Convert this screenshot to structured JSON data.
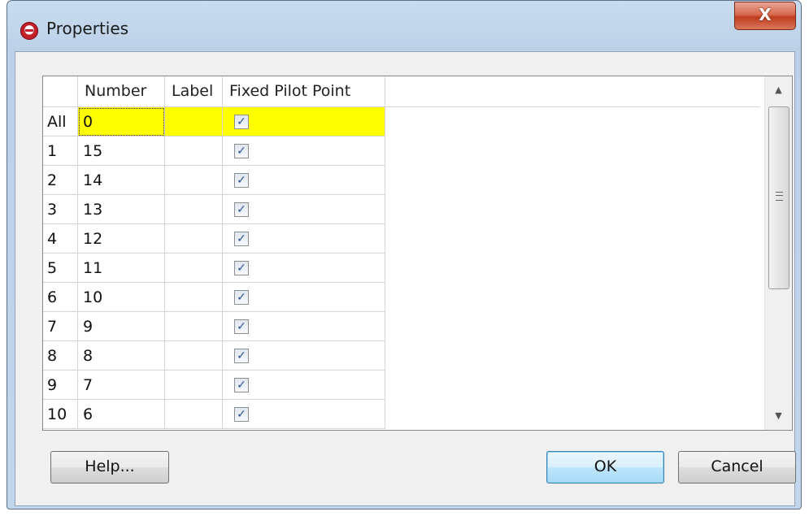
{
  "window": {
    "title": "Properties",
    "close_label": "X"
  },
  "grid": {
    "columns": [
      "Number",
      "Label",
      "Fixed Pilot Point"
    ],
    "rows": [
      {
        "head": "All",
        "number": "0",
        "label": "",
        "fixed": true,
        "highlight": true
      },
      {
        "head": "1",
        "number": "15",
        "label": "",
        "fixed": true
      },
      {
        "head": "2",
        "number": "14",
        "label": "",
        "fixed": true
      },
      {
        "head": "3",
        "number": "13",
        "label": "",
        "fixed": true
      },
      {
        "head": "4",
        "number": "12",
        "label": "",
        "fixed": true
      },
      {
        "head": "5",
        "number": "11",
        "label": "",
        "fixed": true
      },
      {
        "head": "6",
        "number": "10",
        "label": "",
        "fixed": true
      },
      {
        "head": "7",
        "number": "9",
        "label": "",
        "fixed": true
      },
      {
        "head": "8",
        "number": "8",
        "label": "",
        "fixed": true
      },
      {
        "head": "9",
        "number": "7",
        "label": "",
        "fixed": true
      },
      {
        "head": "10",
        "number": "6",
        "label": "",
        "fixed": true
      }
    ],
    "highlight_color": "#ffff00",
    "check_glyph": "✓"
  },
  "scrollbar": {
    "up_glyph": "▲",
    "down_glyph": "▼"
  },
  "buttons": {
    "help_label": "Help...",
    "ok_label": "OK",
    "cancel_label": "Cancel"
  }
}
